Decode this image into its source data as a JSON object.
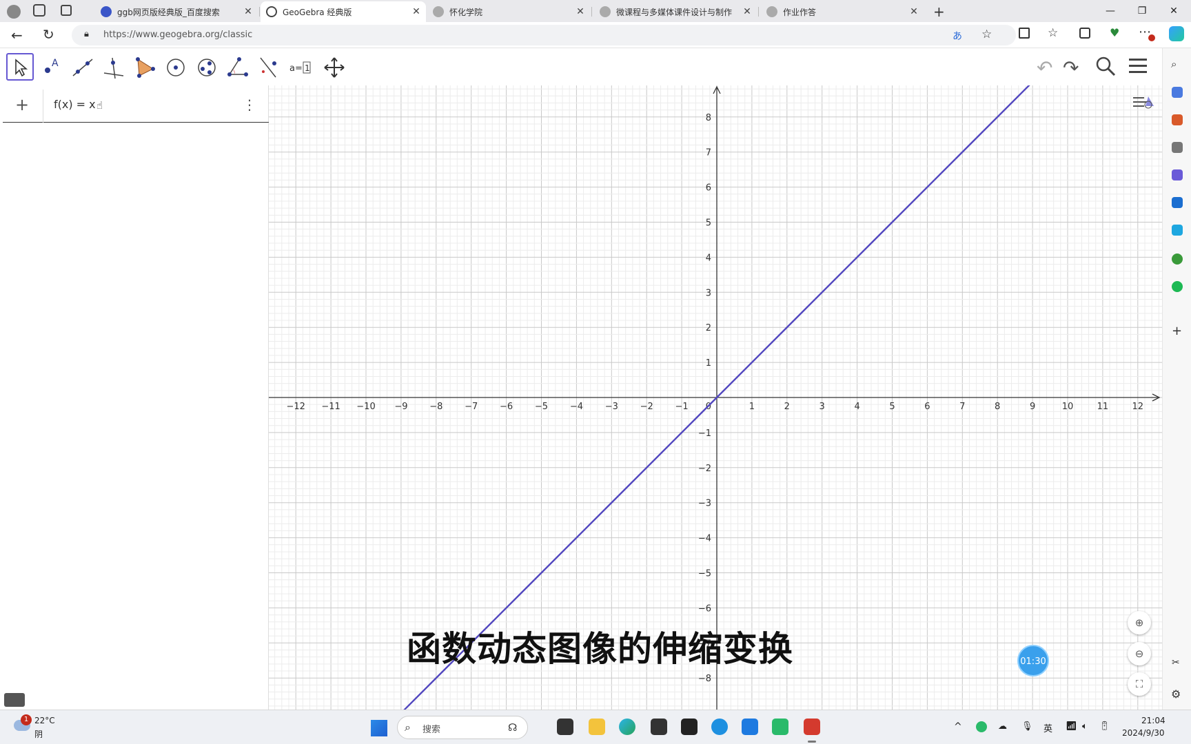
{
  "browser": {
    "tabs": [
      {
        "label": "ggb网页版经典版_百度搜索",
        "active": false,
        "icon": "baidu-icon"
      },
      {
        "label": "GeoGebra 经典版",
        "active": true,
        "icon": "geogebra-icon"
      },
      {
        "label": "怀化学院",
        "active": false,
        "icon": "globe-icon"
      },
      {
        "label": "微课程与多媒体课件设计与制作",
        "active": false,
        "icon": "globe-icon"
      },
      {
        "label": "作业作答",
        "active": false,
        "icon": "globe-icon"
      }
    ],
    "url": "https://www.geogebra.org/classic"
  },
  "algebra": {
    "plus": "+",
    "expression": "f(x) = x",
    "menu": "⋮"
  },
  "chart_data": {
    "type": "line",
    "series": [
      {
        "expr": "f(x) = x",
        "x": [
          -9,
          9
        ],
        "y": [
          -9,
          9
        ],
        "color": "#5247bf"
      }
    ],
    "xlim": [
      -12.5,
      12.5
    ],
    "ylim": [
      -8.6,
      8.9
    ],
    "xticks": [
      -12,
      -11,
      -10,
      -9,
      -8,
      -7,
      -6,
      -5,
      -4,
      -3,
      -2,
      -1,
      1,
      2,
      3,
      4,
      5,
      6,
      7,
      8,
      9,
      10,
      11,
      12
    ],
    "yticks": [
      -8,
      -7,
      -6,
      -5,
      -4,
      -3,
      -2,
      -1,
      1,
      2,
      3,
      4,
      5,
      6,
      7,
      8
    ],
    "origin_label": "0",
    "grid": true
  },
  "caption": "函数动态图像的伸缩变换",
  "timer": "01:30",
  "taskbar": {
    "weather_temp": "22°C",
    "weather_desc": "阴",
    "weather_badge": "1",
    "search_placeholder": "搜索",
    "input_lang": "英",
    "time": "21:04",
    "date": "2024/9/30"
  }
}
